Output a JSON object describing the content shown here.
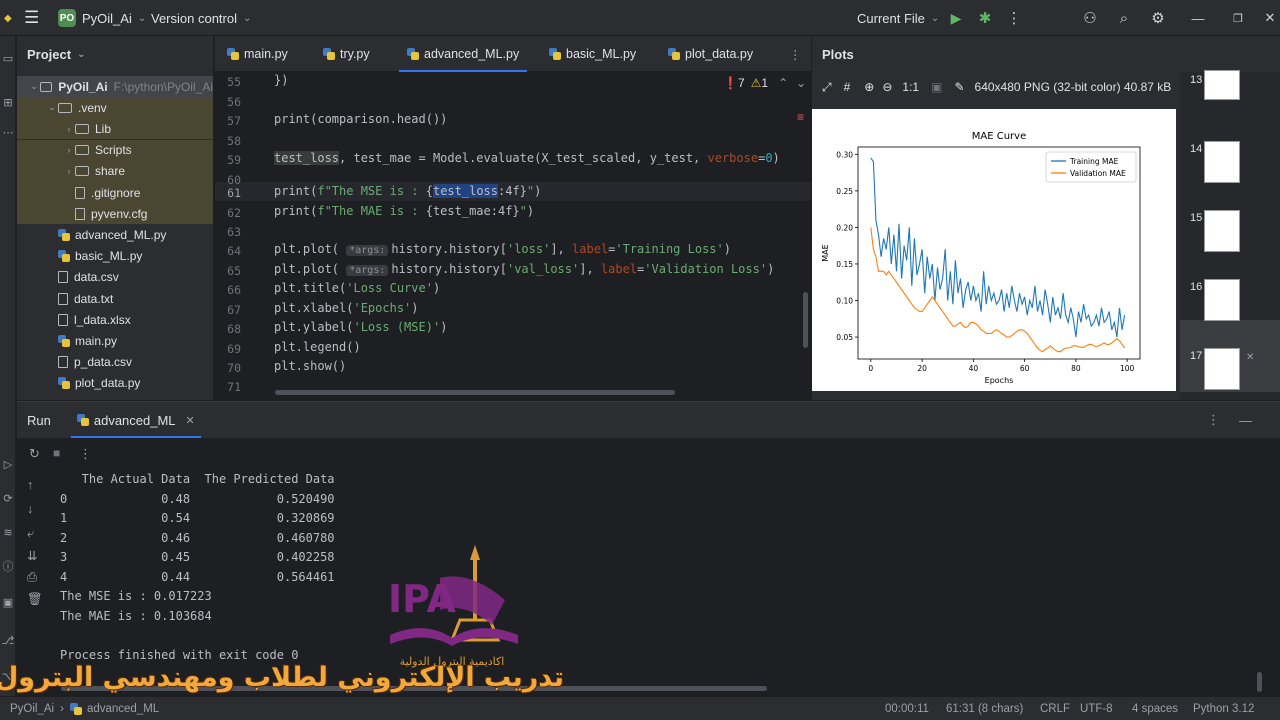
{
  "titlebar": {
    "project_badge": "PO",
    "project_name": "PyOil_Ai",
    "vcs": "Version control",
    "run_config": "Current File"
  },
  "project_panel": {
    "title": "Project",
    "tree": [
      {
        "label": "PyOil_Ai",
        "extra": "F:\\python\\PyOil_Ai",
        "kind": "folder",
        "depth": 0,
        "open": true
      },
      {
        "label": ".venv",
        "kind": "folder",
        "depth": 1,
        "open": true
      },
      {
        "label": "Lib",
        "kind": "folder",
        "depth": 2
      },
      {
        "label": "Scripts",
        "kind": "folder",
        "depth": 2
      },
      {
        "label": "share",
        "kind": "folder",
        "depth": 2
      },
      {
        "label": ".gitignore",
        "kind": "file",
        "depth": 2
      },
      {
        "label": "pyvenv.cfg",
        "kind": "file",
        "depth": 2
      },
      {
        "label": "advanced_ML.py",
        "kind": "py",
        "depth": 1
      },
      {
        "label": "basic_ML.py",
        "kind": "py",
        "depth": 1
      },
      {
        "label": "data.csv",
        "kind": "file",
        "depth": 1
      },
      {
        "label": "data.txt",
        "kind": "file",
        "depth": 1
      },
      {
        "label": "l_data.xlsx",
        "kind": "file",
        "depth": 1
      },
      {
        "label": "main.py",
        "kind": "py",
        "depth": 1
      },
      {
        "label": "p_data.csv",
        "kind": "file",
        "depth": 1
      },
      {
        "label": "plot_data.py",
        "kind": "py",
        "depth": 1
      }
    ]
  },
  "editor": {
    "tabs": [
      "main.py",
      "try.py",
      "advanced_ML.py",
      "basic_ML.py",
      "plot_data.py"
    ],
    "active_tab": "advanced_ML.py",
    "errors": "7",
    "warnings": "1",
    "line_numbers": [
      "55",
      "56",
      "57",
      "58",
      "59",
      "60",
      "61",
      "62",
      "63",
      "64",
      "65",
      "66",
      "67",
      "68",
      "69",
      "70",
      "71"
    ]
  },
  "plots": {
    "title": "Plots",
    "zoom": "1:1",
    "image_info": "640x480 PNG (32-bit color) 40.87 kB",
    "thumbnails": [
      "13",
      "14",
      "15",
      "16",
      "17"
    ]
  },
  "chart_data": {
    "type": "line",
    "title": "MAE Curve",
    "xlabel": "Epochs",
    "ylabel": "MAE",
    "xlim": [
      -5,
      105
    ],
    "ylim": [
      0.02,
      0.31
    ],
    "xticks": [
      0,
      20,
      40,
      60,
      80,
      100
    ],
    "yticks": [
      0.05,
      0.1,
      0.15,
      0.2,
      0.25,
      0.3
    ],
    "legend_position": "top-right",
    "series": [
      {
        "name": "Training MAE",
        "color": "#1f77b4",
        "x": [
          0,
          1,
          2,
          3,
          4,
          5,
          6,
          7,
          8,
          9,
          10,
          11,
          12,
          13,
          14,
          15,
          16,
          17,
          18,
          19,
          20,
          21,
          22,
          23,
          24,
          25,
          26,
          27,
          28,
          29,
          30,
          31,
          32,
          33,
          34,
          35,
          36,
          37,
          38,
          39,
          40,
          41,
          42,
          43,
          44,
          45,
          46,
          47,
          48,
          49,
          50,
          51,
          52,
          53,
          54,
          55,
          56,
          57,
          58,
          59,
          60,
          61,
          62,
          63,
          64,
          65,
          66,
          67,
          68,
          69,
          70,
          71,
          72,
          73,
          74,
          75,
          76,
          77,
          78,
          79,
          80,
          81,
          82,
          83,
          84,
          85,
          86,
          87,
          88,
          89,
          90,
          91,
          92,
          93,
          94,
          95,
          96,
          97,
          98,
          99
        ],
        "y": [
          0.295,
          0.29,
          0.21,
          0.19,
          0.16,
          0.185,
          0.17,
          0.2,
          0.15,
          0.19,
          0.14,
          0.205,
          0.13,
          0.175,
          0.155,
          0.2,
          0.12,
          0.185,
          0.135,
          0.15,
          0.17,
          0.11,
          0.16,
          0.13,
          0.15,
          0.1,
          0.145,
          0.115,
          0.13,
          0.17,
          0.1,
          0.14,
          0.095,
          0.155,
          0.11,
          0.13,
          0.09,
          0.115,
          0.125,
          0.1,
          0.12,
          0.1,
          0.11,
          0.085,
          0.14,
          0.095,
          0.12,
          0.1,
          0.11,
          0.095,
          0.1,
          0.115,
          0.085,
          0.11,
          0.09,
          0.12,
          0.1,
          0.085,
          0.11,
          0.095,
          0.105,
          0.08,
          0.1,
          0.09,
          0.12,
          0.085,
          0.1,
          0.08,
          0.115,
          0.095,
          0.07,
          0.105,
          0.08,
          0.09,
          0.075,
          0.11,
          0.08,
          0.07,
          0.09,
          0.075,
          0.05,
          0.085,
          0.07,
          0.095,
          0.075,
          0.08,
          0.065,
          0.07,
          0.08,
          0.065,
          0.09,
          0.07,
          0.075,
          0.085,
          0.06,
          0.07,
          0.05,
          0.09,
          0.06,
          0.08
        ]
      },
      {
        "name": "Validation MAE",
        "color": "#ff7f0e",
        "x": [
          0,
          1,
          2,
          3,
          4,
          5,
          6,
          7,
          8,
          9,
          10,
          11,
          12,
          13,
          14,
          15,
          16,
          17,
          18,
          19,
          20,
          21,
          22,
          23,
          24,
          25,
          26,
          27,
          28,
          29,
          30,
          31,
          32,
          33,
          34,
          35,
          36,
          37,
          38,
          39,
          40,
          41,
          42,
          43,
          44,
          45,
          46,
          47,
          48,
          49,
          50,
          51,
          52,
          53,
          54,
          55,
          56,
          57,
          58,
          59,
          60,
          61,
          62,
          63,
          64,
          65,
          66,
          67,
          68,
          69,
          70,
          71,
          72,
          73,
          74,
          75,
          76,
          77,
          78,
          79,
          80,
          81,
          82,
          83,
          84,
          85,
          86,
          87,
          88,
          89,
          90,
          91,
          92,
          93,
          94,
          95,
          96,
          97,
          98,
          99
        ],
        "y": [
          0.2,
          0.17,
          0.16,
          0.14,
          0.14,
          0.14,
          0.135,
          0.14,
          0.135,
          0.13,
          0.125,
          0.12,
          0.115,
          0.11,
          0.105,
          0.1,
          0.095,
          0.09,
          0.088,
          0.085,
          0.085,
          0.09,
          0.095,
          0.1,
          0.105,
          0.1,
          0.095,
          0.09,
          0.085,
          0.08,
          0.075,
          0.07,
          0.065,
          0.065,
          0.068,
          0.07,
          0.065,
          0.063,
          0.065,
          0.07,
          0.07,
          0.068,
          0.065,
          0.06,
          0.058,
          0.055,
          0.055,
          0.055,
          0.058,
          0.06,
          0.058,
          0.055,
          0.053,
          0.05,
          0.05,
          0.052,
          0.055,
          0.058,
          0.06,
          0.06,
          0.058,
          0.055,
          0.05,
          0.045,
          0.04,
          0.035,
          0.032,
          0.03,
          0.033,
          0.035,
          0.038,
          0.035,
          0.032,
          0.03,
          0.03,
          0.033,
          0.035,
          0.035,
          0.036,
          0.038,
          0.038,
          0.037,
          0.036,
          0.036,
          0.038,
          0.04,
          0.04,
          0.038,
          0.037,
          0.038,
          0.04,
          0.042,
          0.04,
          0.04,
          0.042,
          0.045,
          0.048,
          0.045,
          0.04,
          0.035
        ]
      }
    ]
  },
  "run_panel": {
    "title": "Run",
    "tab": "advanced_ML",
    "output": [
      "   The Actual Data  The Predicted Data",
      "0             0.48            0.520490",
      "1             0.54            0.320869",
      "2             0.46            0.460780",
      "3             0.45            0.402258",
      "4             0.44            0.564461",
      "The MSE is : 0.017223",
      "The MAE is : 0.103684",
      "",
      "Process finished with exit code 0"
    ]
  },
  "status": {
    "breadcrumb_project": "PyOil_Ai",
    "breadcrumb_file": "advanced_ML",
    "time": "00:00:11",
    "position": "61:31 (8 chars)",
    "line_sep": "CRLF",
    "encoding": "UTF-8",
    "indent": "4 spaces",
    "interpreter": "Python 3.12"
  },
  "watermark": {
    "logo_text": "IPA",
    "academy_name": "اكاديمية البترول الدولية",
    "banner": "تدريب الإلكتروني لطلاب ومهندسي البترول"
  }
}
